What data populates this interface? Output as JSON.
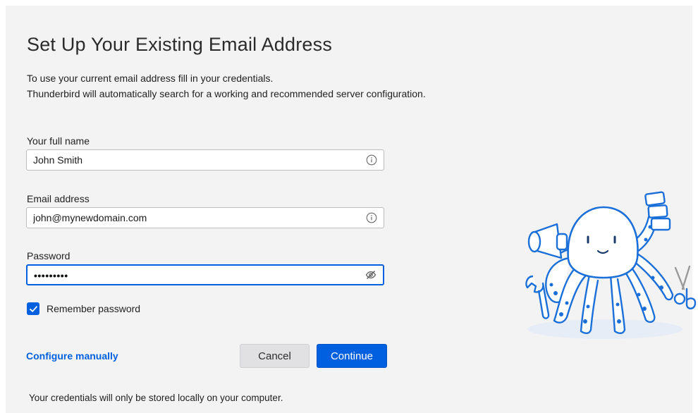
{
  "setup": {
    "title": "Set Up Your Existing Email Address",
    "intro_line1": "To use your current email address fill in your credentials.",
    "intro_line2": "Thunderbird will automatically search for a working and recommended server configuration."
  },
  "form": {
    "fullname_label": "Your full name",
    "fullname_value": "John Smith",
    "email_label": "Email address",
    "email_value": "john@mynewdomain.com",
    "password_label": "Password",
    "password_mask": "•••••••••",
    "remember_label": "Remember password",
    "remember_checked": true
  },
  "actions": {
    "configure_manually": "Configure manually",
    "cancel": "Cancel",
    "continue": "Continue"
  },
  "footer": {
    "note": "Your credentials will only be stored locally on your computer."
  },
  "icons": {
    "info": "info-icon",
    "password_visibility": "eye-slash-icon",
    "check": "checkmark-icon",
    "mascot": "octopus-mascot-illustration"
  },
  "colors": {
    "accent": "#0060df",
    "panel_bg": "#f3f3f3",
    "link": "#0061e0",
    "mascot_outline": "#1b6fd8"
  }
}
